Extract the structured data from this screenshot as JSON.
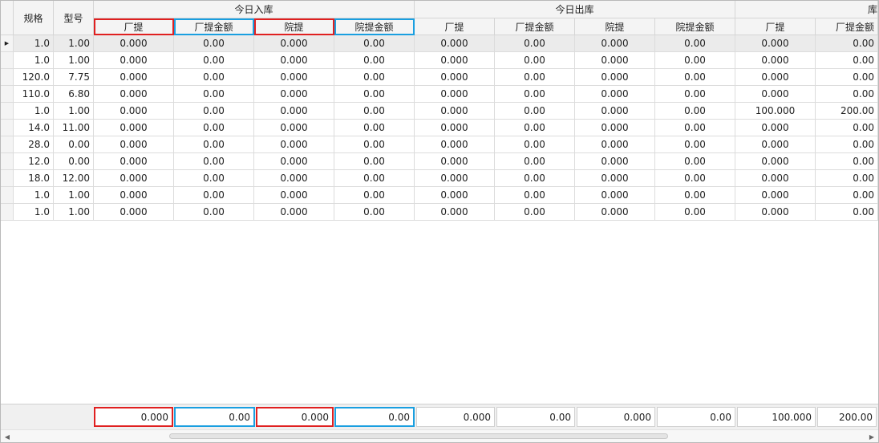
{
  "columns": {
    "guige": "规格",
    "xinghao": "型号",
    "group_in": "今日入库",
    "group_out": "今日出库",
    "group_third": "库",
    "sub": [
      "厂提",
      "厂提金额",
      "院提",
      "院提金额",
      "厂提",
      "厂提金额",
      "院提",
      "院提金额",
      "厂提",
      "厂提金额"
    ]
  },
  "rows": [
    [
      "1.0",
      "1.00",
      "0.000",
      "0.00",
      "0.000",
      "0.00",
      "0.000",
      "0.00",
      "0.000",
      "0.00",
      "0.000",
      "0.00"
    ],
    [
      "1.0",
      "1.00",
      "0.000",
      "0.00",
      "0.000",
      "0.00",
      "0.000",
      "0.00",
      "0.000",
      "0.00",
      "0.000",
      "0.00"
    ],
    [
      "120.0",
      "7.75",
      "0.000",
      "0.00",
      "0.000",
      "0.00",
      "0.000",
      "0.00",
      "0.000",
      "0.00",
      "0.000",
      "0.00"
    ],
    [
      "110.0",
      "6.80",
      "0.000",
      "0.00",
      "0.000",
      "0.00",
      "0.000",
      "0.00",
      "0.000",
      "0.00",
      "0.000",
      "0.00"
    ],
    [
      "1.0",
      "1.00",
      "0.000",
      "0.00",
      "0.000",
      "0.00",
      "0.000",
      "0.00",
      "0.000",
      "0.00",
      "100.000",
      "200.00"
    ],
    [
      "14.0",
      "11.00",
      "0.000",
      "0.00",
      "0.000",
      "0.00",
      "0.000",
      "0.00",
      "0.000",
      "0.00",
      "0.000",
      "0.00"
    ],
    [
      "28.0",
      "0.00",
      "0.000",
      "0.00",
      "0.000",
      "0.00",
      "0.000",
      "0.00",
      "0.000",
      "0.00",
      "0.000",
      "0.00"
    ],
    [
      "12.0",
      "0.00",
      "0.000",
      "0.00",
      "0.000",
      "0.00",
      "0.000",
      "0.00",
      "0.000",
      "0.00",
      "0.000",
      "0.00"
    ],
    [
      "18.0",
      "12.00",
      "0.000",
      "0.00",
      "0.000",
      "0.00",
      "0.000",
      "0.00",
      "0.000",
      "0.00",
      "0.000",
      "0.00"
    ],
    [
      "1.0",
      "1.00",
      "0.000",
      "0.00",
      "0.000",
      "0.00",
      "0.000",
      "0.00",
      "0.000",
      "0.00",
      "0.000",
      "0.00"
    ],
    [
      "1.0",
      "1.00",
      "0.000",
      "0.00",
      "0.000",
      "0.00",
      "0.000",
      "0.00",
      "0.000",
      "0.00",
      "0.000",
      "0.00"
    ]
  ],
  "selected_row": 0,
  "totals": [
    "0.000",
    "0.00",
    "0.000",
    "0.00",
    "0.000",
    "0.00",
    "0.000",
    "0.00",
    "100.000",
    "200.00"
  ],
  "icons": {
    "row_indicator": "row-indicator-arrow-icon",
    "scroll_left": "scroll-left-arrow-icon",
    "scroll_right": "scroll-right-arrow-icon"
  },
  "colors": {
    "highlight_red": "#e02020",
    "highlight_blue": "#1a9fe0"
  }
}
